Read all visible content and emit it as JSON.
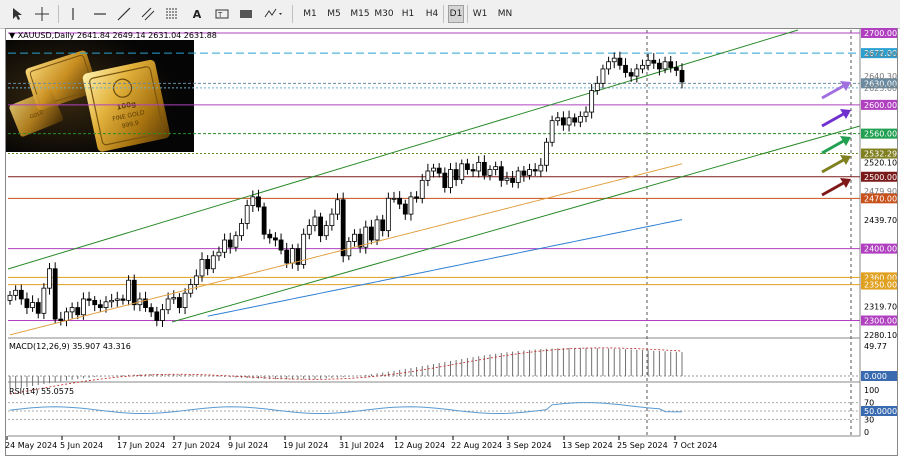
{
  "toolbar": {
    "timeframes": [
      "M1",
      "M5",
      "M15",
      "M30",
      "H1",
      "H4",
      "D1",
      "W1",
      "MN"
    ],
    "active_timeframe": "D1"
  },
  "chart": {
    "header": "XAUUSD,Daily  2641.84 2649.14 2631.04 2631.88",
    "price_labels": [
      "2700.00",
      "2672.00",
      "2630.00",
      "2600.00",
      "2560.00",
      "2532.29",
      "2520.10",
      "2500.00",
      "2470.00",
      "2439.70",
      "2400.00",
      "2360.00",
      "2350.00",
      "2319.70",
      "2300.00",
      "2280.10"
    ],
    "dim_price_labels": [
      "2670.50",
      "2640.30",
      "2623.60",
      "2479.90"
    ],
    "date_labels": [
      "24 May 2024",
      "5 Jun 2024",
      "17 Jun 2024",
      "27 Jun 2024",
      "9 Jul 2024",
      "19 Jul 2024",
      "31 Jul 2024",
      "12 Aug 2024",
      "22 Aug 2024",
      "3 Sep 2024",
      "13 Sep 2024",
      "25 Sep 2024",
      "7 Oct 2024"
    ],
    "macd_header": "MACD(12,26,9) 35.907 43.316",
    "macd_labels": [
      "49.77",
      "0.000"
    ],
    "rsi_header": "RSI(14) 55.0575",
    "rsi_labels": [
      "100",
      "70",
      "50.0000",
      "30",
      "0"
    ],
    "photo_text": [
      "GOLD",
      "FINE GOLD",
      "999.9",
      "100g"
    ],
    "colors": {
      "up": "#ffffff",
      "down": "#000000",
      "channel": "#2a8a2a",
      "ma_slow": "#2f7fd4",
      "ma_fast": "#e0a040",
      "macd": "#707070",
      "rsi": "#5a9ad0"
    }
  }
}
